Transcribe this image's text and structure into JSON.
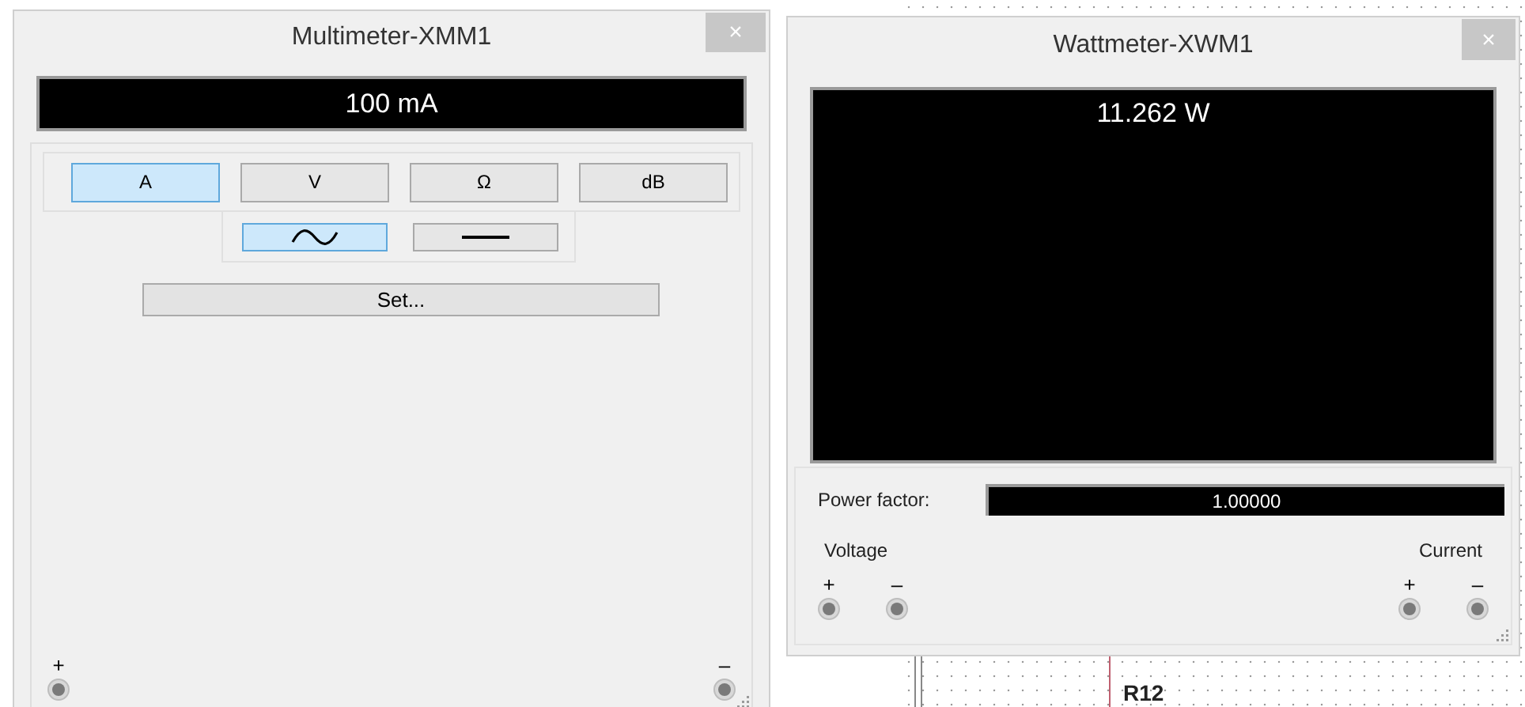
{
  "schematic": {
    "label": "R12"
  },
  "multimeter": {
    "title": "Multimeter-XMM1",
    "close": "×",
    "reading": "100 mA",
    "modes": [
      {
        "label": "A",
        "selected": true
      },
      {
        "label": "V",
        "selected": false
      },
      {
        "label": "Ω",
        "selected": false
      },
      {
        "label": "dB",
        "selected": false
      }
    ],
    "signals": [
      {
        "kind": "ac",
        "selected": true
      },
      {
        "kind": "dc",
        "selected": false
      }
    ],
    "set_button": "Set...",
    "terminals": [
      {
        "sign": "+"
      },
      {
        "sign": "–"
      }
    ]
  },
  "wattmeter": {
    "title": "Wattmeter-XWM1",
    "close": "×",
    "reading": "11.262 W",
    "power_factor": {
      "label": "Power factor:",
      "value": "1.00000"
    },
    "groups": [
      {
        "label": "Voltage",
        "terminals": [
          {
            "sign": "+"
          },
          {
            "sign": "–"
          }
        ]
      },
      {
        "label": "Current",
        "terminals": [
          {
            "sign": "+"
          },
          {
            "sign": "–"
          }
        ]
      }
    ]
  }
}
